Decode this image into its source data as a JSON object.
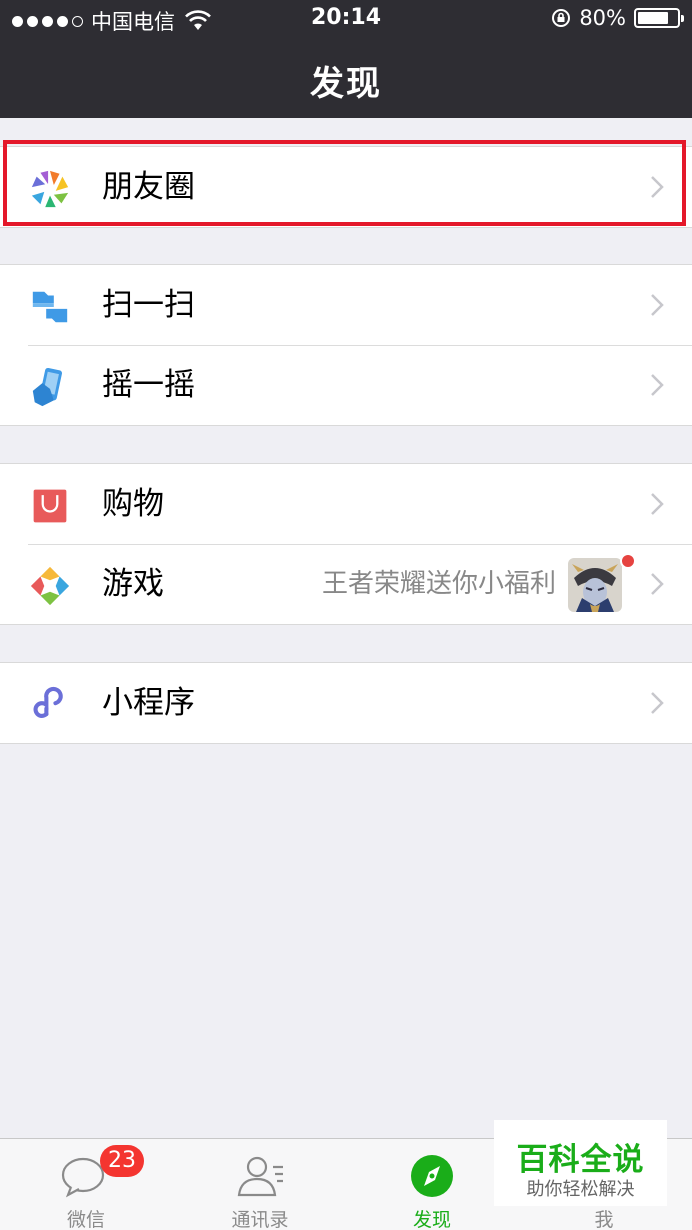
{
  "status_bar": {
    "carrier": "中国电信",
    "time": "20:14",
    "battery": "80%",
    "battery_level": 0.8,
    "signal_bars": 4
  },
  "nav": {
    "title": "发现"
  },
  "groups": [
    {
      "items": [
        {
          "label": "朋友圈",
          "icon": "moments-aperture-icon"
        }
      ]
    },
    {
      "items": [
        {
          "label": "扫一扫",
          "icon": "scan-icon"
        },
        {
          "label": "摇一摇",
          "icon": "shake-phone-icon"
        }
      ]
    },
    {
      "items": [
        {
          "label": "购物",
          "icon": "shopping-bag-icon"
        },
        {
          "label": "游戏",
          "icon": "games-diamond-icon",
          "extra_text": "王者荣耀送你小福利"
        }
      ]
    },
    {
      "items": [
        {
          "label": "小程序",
          "icon": "mini-program-icon"
        }
      ]
    }
  ],
  "tabbar": {
    "tabs": [
      {
        "label": "微信",
        "icon": "chat-bubble-icon",
        "badge": "23"
      },
      {
        "label": "通讯录",
        "icon": "contacts-icon"
      },
      {
        "label": "发现",
        "icon": "compass-icon",
        "active": true
      },
      {
        "label": "我",
        "icon": "me-icon"
      }
    ]
  },
  "watermark": {
    "title": "百科全说",
    "subtitle": "助你轻松解决"
  },
  "colors": {
    "accent": "#1aad19",
    "highlight_border": "#e4182a",
    "badge": "#f43530",
    "navbar": "#2e2d33"
  }
}
